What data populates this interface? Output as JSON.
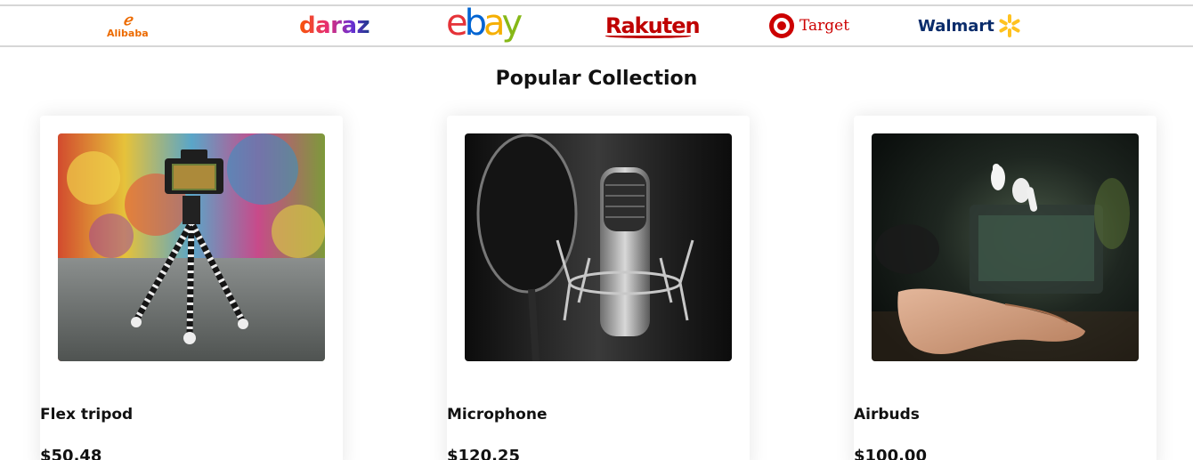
{
  "brands": {
    "alibaba": {
      "mark": "ℯ",
      "text": "Alibaba",
      "color": "#ec6a00"
    },
    "daraz": {
      "text": "daraz"
    },
    "ebay": {
      "letters": [
        "e",
        "b",
        "a",
        "y"
      ],
      "colors": [
        "#e53238",
        "#0064d2",
        "#f5af02",
        "#86b817"
      ]
    },
    "rakuten": {
      "text": "Rakuten",
      "color": "#bf0000"
    },
    "target": {
      "text": "Target",
      "color": "#cc0000"
    },
    "walmart": {
      "text": "Walmart",
      "color": "#0a2c6b",
      "spark_color": "#ffc220"
    }
  },
  "section": {
    "title": "Popular Collection"
  },
  "products": [
    {
      "name": "Flex tripod",
      "price": "$50.48",
      "image": "tripod-camera-photo"
    },
    {
      "name": "Microphone",
      "price": "$120.25",
      "image": "studio-microphone-photo"
    },
    {
      "name": "Airbuds",
      "price": "$100.00",
      "image": "floating-airbuds-photo"
    }
  ]
}
